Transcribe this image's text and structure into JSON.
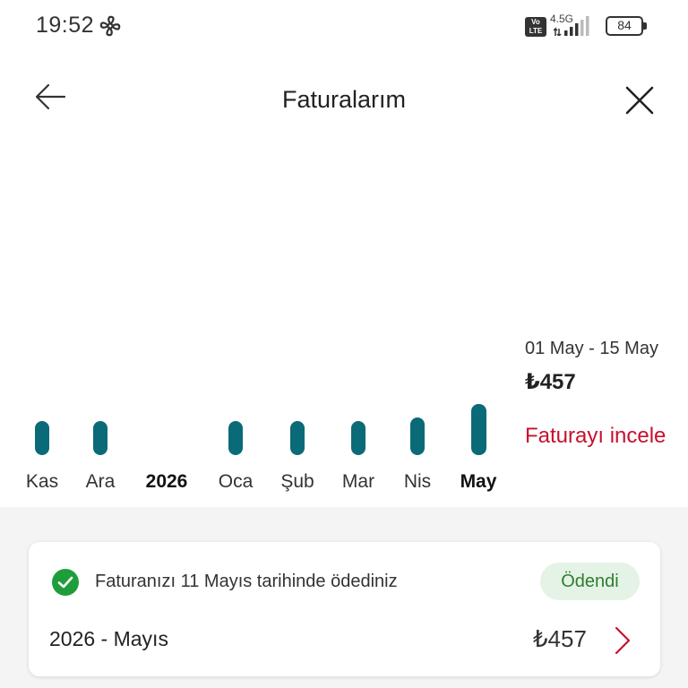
{
  "status_bar": {
    "time": "19:52",
    "network": "4.5G",
    "volte": "Vo LTE",
    "battery": "84"
  },
  "header": {
    "title": "Faturalarım"
  },
  "chart_data": {
    "type": "bar",
    "categories": [
      "Kas",
      "Ara",
      "Oca",
      "Şub",
      "Mar",
      "Nis",
      "May"
    ],
    "values": [
      1.0,
      1.0,
      1.0,
      1.0,
      1.0,
      1.1,
      1.5
    ],
    "year_separator": "2026",
    "selected": "May",
    "colors": {
      "bar": "#0a6a78"
    }
  },
  "selected_bill": {
    "period": "01 May - 15 May",
    "amount": "₺457",
    "view_link": "Faturayı incele"
  },
  "bill_card": {
    "message": "Faturanızı 11 Mayıs tarihinde ödediniz",
    "status_badge": "Ödendi",
    "period": "2026 - Mayıs",
    "amount": "₺457"
  },
  "colors": {
    "accent_red": "#c8102e",
    "teal": "#0a6a78",
    "paid_green": "#2e7d32"
  }
}
